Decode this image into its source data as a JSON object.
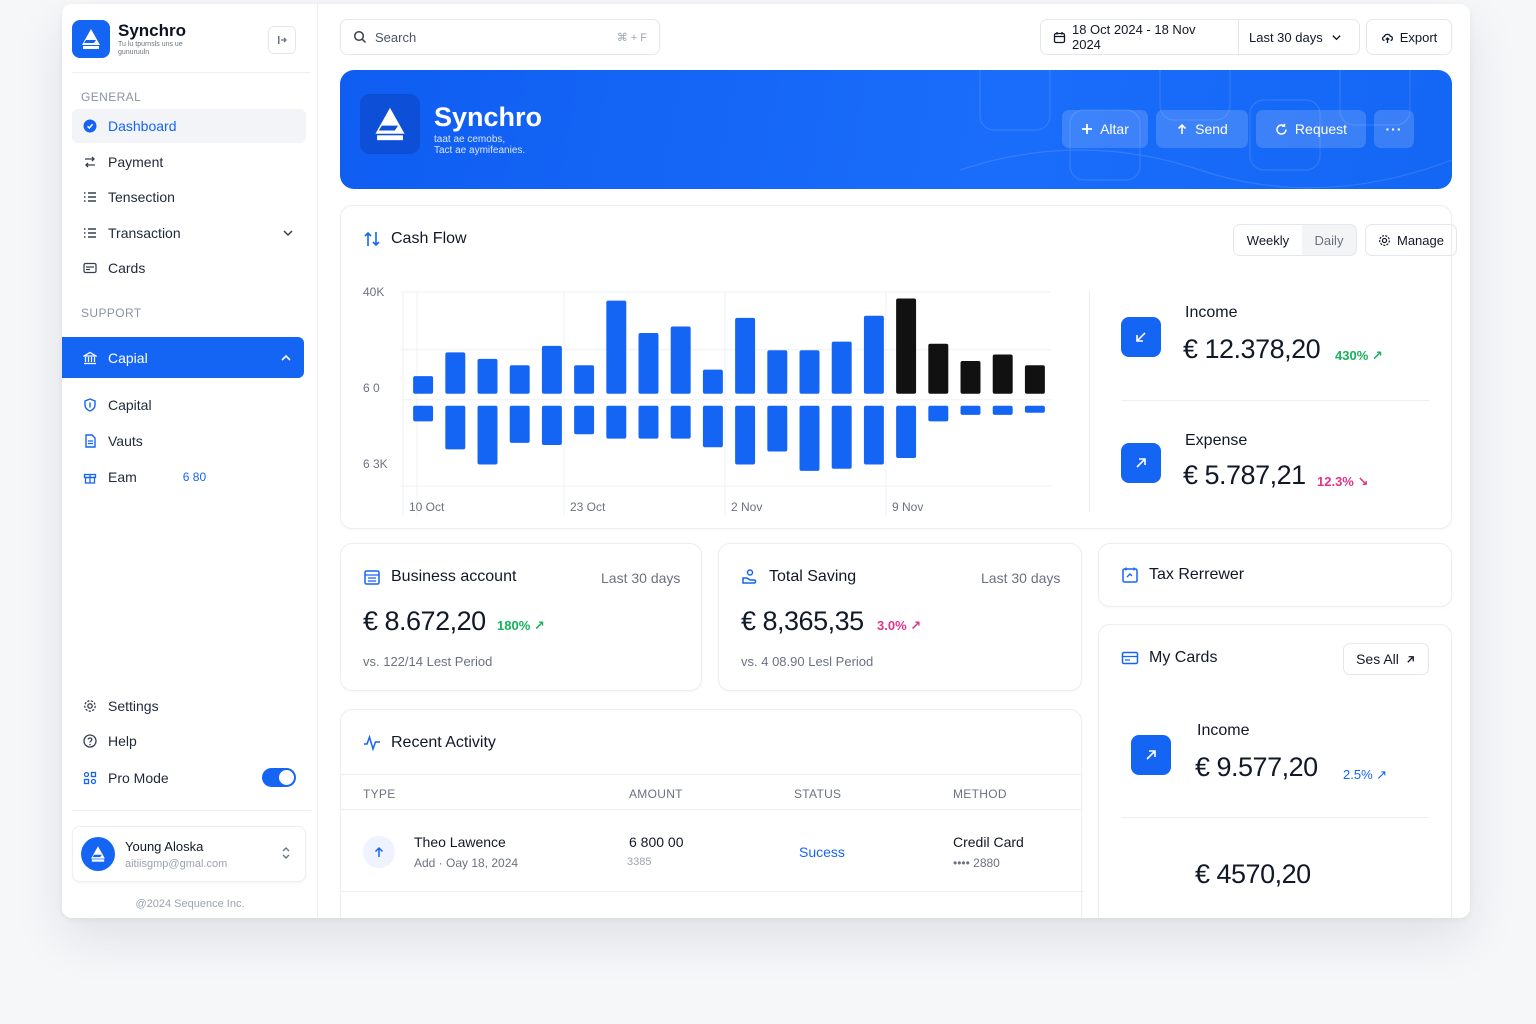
{
  "brand": {
    "name": "Synchro",
    "tagline": "Tu lu tpurnsls uns ue gunuruuln"
  },
  "sidebar": {
    "general_label": "GENERAL",
    "support_label": "SUPPORT",
    "general_items": [
      {
        "label": "Dashboard",
        "icon": "dashboard-icon",
        "active": true
      },
      {
        "label": "Payment",
        "icon": "transfer-icon"
      },
      {
        "label": "Tensection",
        "icon": "list-icon"
      },
      {
        "label": "Transaction",
        "icon": "list-icon",
        "expandable": true
      },
      {
        "label": "Cards",
        "icon": "card-icon"
      }
    ],
    "support_group": {
      "label": "Capial",
      "icon": "bank-icon",
      "expanded": true
    },
    "support_items": [
      {
        "label": "Capital",
        "icon": "shield-icon"
      },
      {
        "label": "Vauts",
        "icon": "document-icon"
      },
      {
        "label": "Eam",
        "icon": "gift-icon",
        "badge": "6 80"
      }
    ],
    "bottom_items": [
      {
        "label": "Settings",
        "icon": "gear-icon"
      },
      {
        "label": "Help",
        "icon": "help-icon"
      },
      {
        "label": "Pro Mode",
        "icon": "grid-icon",
        "toggle_on": true
      }
    ],
    "user": {
      "name": "Young Aloska",
      "email": "aitiisgmp@gmal.com"
    },
    "copyright": "@2024 Sequence Inc."
  },
  "topbar": {
    "search_placeholder": "Search",
    "search_shortcut": "⌘ + F",
    "date_range": "18 Oct 2024 - 18 Nov 2024",
    "period": "Last 30 days",
    "export_label": "Export"
  },
  "hero": {
    "title": "Synchro",
    "sub_line1": "taat ae cemobs,",
    "sub_line2": "Tact ae aymifeanies.",
    "buttons": [
      "Altar",
      "Send",
      "Request"
    ],
    "more_label": "···"
  },
  "cashflow": {
    "title": "Cash Flow",
    "toggle_on": "Weekly",
    "toggle_off": "Daily",
    "manage_label": "Manage",
    "income": {
      "label": "Income",
      "value": "€ 12.378,20",
      "pct": "430%",
      "pct_arrow": "↗"
    },
    "expense": {
      "label": "Expense",
      "value": "€ 5.787,21",
      "pct": "12.3%",
      "pct_arrow": "↘"
    }
  },
  "chart_data": {
    "type": "bar",
    "y_tick_labels": [
      "40K",
      "6 0",
      "6 3K"
    ],
    "x_tick_labels": [
      "10 Oct",
      "23 Oct",
      "2 Nov",
      "9 Nov"
    ],
    "ylim": [
      -40,
      50
    ],
    "series": [
      {
        "values": [
          11,
          22,
          19,
          16,
          25,
          16,
          46,
          31,
          34,
          14,
          38,
          23,
          23,
          27,
          39,
          47,
          26,
          18,
          21,
          16
        ]
      },
      {
        "values": [
          -10,
          -23,
          -30,
          -20,
          -21,
          -16,
          -18,
          -18,
          -18,
          -22,
          -30,
          -24,
          -33,
          -32,
          -30,
          -27,
          -10,
          -7,
          -7,
          -6
        ]
      }
    ],
    "highlight_from_index": 15,
    "colors": {
      "highlight": "#111111",
      "base": "#1565f5"
    },
    "grid": true
  },
  "business_account": {
    "title": "Business account",
    "period": "Last 30 days",
    "value": "€ 8.672,20",
    "pct": "180%",
    "pct_arrow": "↗",
    "comparison": "vs. 122/14 Lest Period"
  },
  "total_saving": {
    "title": "Total Saving",
    "period": "Last 30 days",
    "value": "€ 8,365,35",
    "pct": "3.0%",
    "pct_arrow": "↗",
    "comparison": "vs. 4 08.90 Lesl Period"
  },
  "tax": {
    "title": "Tax Rerrewer"
  },
  "my_cards": {
    "title": "My Cards",
    "see_all": "Ses All",
    "income_label": "Income",
    "income_value": "€ 9.577,20",
    "income_pct": "2.5%",
    "income_pct_arrow": "↗",
    "second_value": "€ 4570,20"
  },
  "recent": {
    "title": "Recent Activity",
    "columns": [
      "TYPE",
      "AMOUNT",
      "STATUS",
      "METHOD"
    ],
    "rows": [
      {
        "name": "Theo Lawence",
        "sub": "Add  ·  Oay 18, 2024",
        "amount": "6 800 00",
        "amount_sub": "3385",
        "status": "Sucess",
        "method": "Credil Card",
        "method_sub": "•••• 2880"
      }
    ]
  },
  "colors": {
    "accent": "#1565f5",
    "success": "#16b35a",
    "danger": "#e0338a"
  }
}
